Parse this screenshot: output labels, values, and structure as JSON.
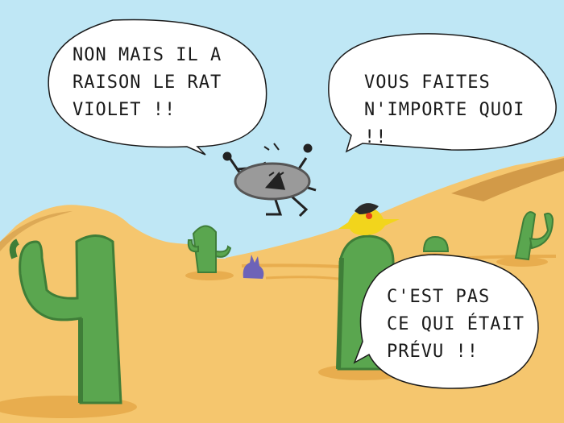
{
  "colors": {
    "sky": "#bfe7f5",
    "sand": "#f5c66e",
    "sand_dark": "#e8ad4e",
    "dune_shadow": "#c68b3c",
    "cactus": "#5aa64f",
    "cactus_dark": "#3f7e38",
    "character": "#9a9a9a",
    "bird": "#f2d51c",
    "rabbit": "#6d63b8"
  },
  "bubbles": {
    "left": "NON MAIS IL A\nRAISON LE RAT\nVIOLET !!",
    "right": "VOUS FAITES\nN'IMPORTE QUOI !!",
    "bottom": "C'EST PAS\nCE QUI ÉTAIT\nPRÉVU !!"
  },
  "icons": {
    "character": "angry-grey-creature-icon",
    "bird": "yellow-bird-icon",
    "rabbit": "purple-rabbit-icon"
  }
}
